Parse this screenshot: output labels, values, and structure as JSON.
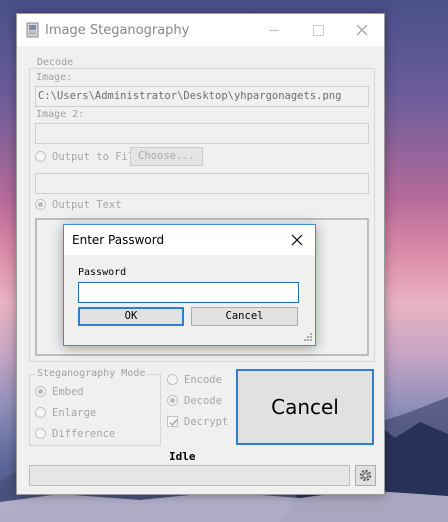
{
  "window": {
    "title": "Image Steganography"
  },
  "decode": {
    "group_label": "Decode",
    "image_label": "Image:",
    "image_path": "C:\\Users\\Administrator\\Desktop\\yhpargonagets.png",
    "image2_label": "Image 2:",
    "image2_value": "",
    "output_to_file_label": "Output to Fil",
    "choose_button": "Choose...",
    "output_file_value": "",
    "output_text_label": "Output Text",
    "output_text_selected": true
  },
  "dialog": {
    "title": "Enter Password",
    "password_label": "Password",
    "password_value": "",
    "ok_label": "OK",
    "cancel_label": "Cancel"
  },
  "mode": {
    "group_label": "Steganography Mode",
    "options": [
      "Embed",
      "Enlarge",
      "Difference"
    ],
    "selected": "Embed"
  },
  "operation": {
    "encode_label": "Encode",
    "decode_label": "Decode",
    "decrypt_label": "Decrypt",
    "selected": "Decode",
    "decrypt_checked": true
  },
  "actions": {
    "cancel_label": "Cancel"
  },
  "status": {
    "text": "Idle",
    "progress": 0
  },
  "icons": {
    "app": "app-icon",
    "settings": "gear-icon"
  }
}
